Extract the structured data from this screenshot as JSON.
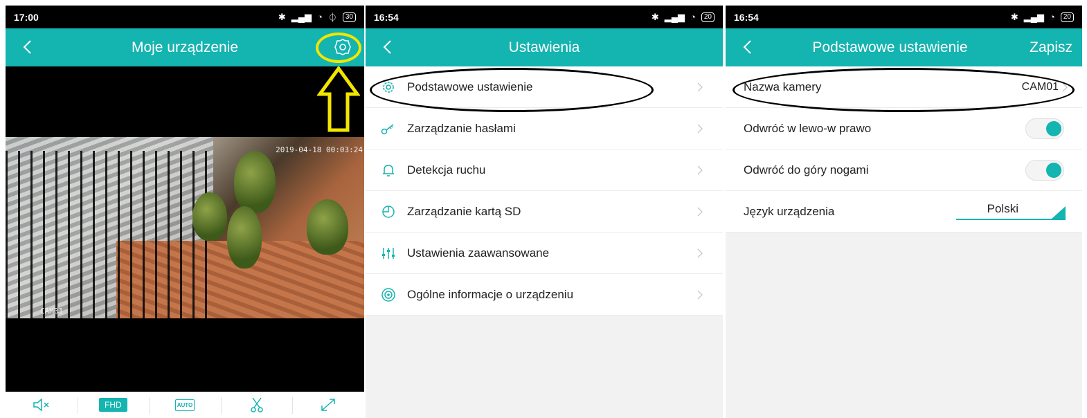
{
  "screens": {
    "s1": {
      "status": {
        "time": "17:00",
        "battery": "30"
      },
      "title": "Moje urządzenie",
      "camera_overlay": {
        "timestamp": "2019-04-18 00:03:24",
        "camera_label": "CAM01"
      },
      "controls": {
        "quality_label": "FHD",
        "auto_label": "AUTO"
      }
    },
    "s2": {
      "status": {
        "time": "16:54",
        "battery": "20"
      },
      "title": "Ustawienia",
      "menu": [
        {
          "label": "Podstawowe ustawienie",
          "icon": "gear-icon"
        },
        {
          "label": "Zarządzanie hasłami",
          "icon": "key-icon"
        },
        {
          "label": "Detekcja ruchu",
          "icon": "bell-icon"
        },
        {
          "label": "Zarządzanie kartą SD",
          "icon": "sd-card-icon"
        },
        {
          "label": "Ustawienia zaawansowane",
          "icon": "sliders-icon"
        },
        {
          "label": "Ogólne informacje o urządzeniu",
          "icon": "info-icon"
        }
      ]
    },
    "s3": {
      "status": {
        "time": "16:54",
        "battery": "20"
      },
      "title": "Podstawowe ustawienie",
      "save_label": "Zapisz",
      "rows": {
        "camera_name": {
          "label": "Nazwa kamery",
          "value": "CAM01"
        },
        "flip_horizontal": {
          "label": "Odwróć w lewo-w prawo",
          "on": true
        },
        "flip_vertical": {
          "label": "Odwróć do góry nogami",
          "on": true
        },
        "language": {
          "label": "Język urządzenia",
          "value": "Polski"
        }
      }
    }
  },
  "colors": {
    "accent": "#14b4b0",
    "annotation_yellow": "#f2e600",
    "annotation_black": "#000000"
  }
}
